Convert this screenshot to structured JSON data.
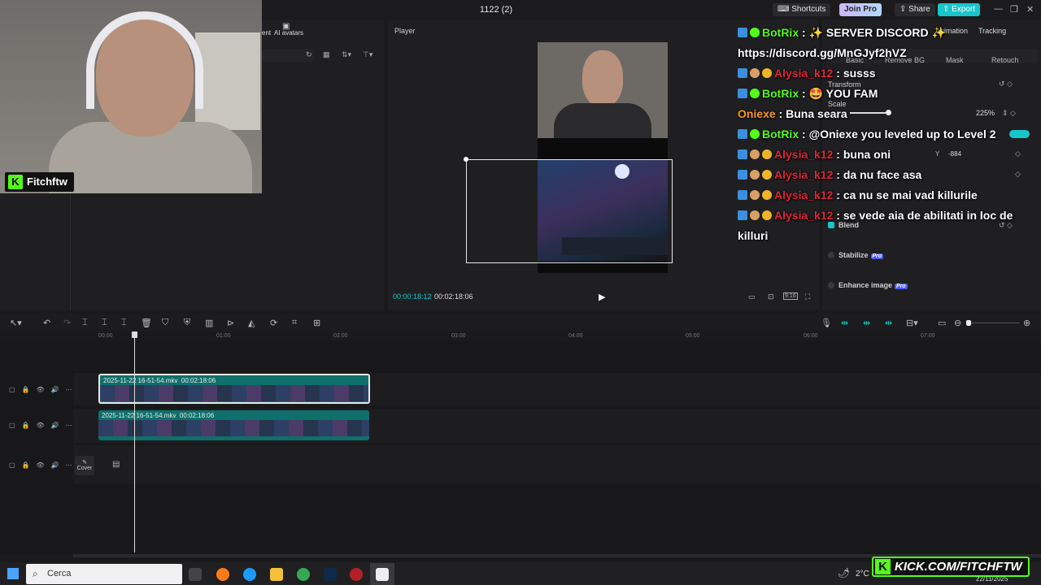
{
  "window": {
    "title": "1122 (2)"
  },
  "header": {
    "shortcuts_label": "Shortcuts",
    "join_pro_label": "Join Pro",
    "share_label": "Share",
    "export_label": "Export"
  },
  "left_panel": {
    "ai_avatars_label": "AI avatars",
    "left_cut_label": "ent"
  },
  "player": {
    "label": "Player",
    "current_time": "00:00:18:12",
    "total_time": "00:02:18:06",
    "ratio_label": "9:16"
  },
  "right_panel": {
    "tabs": [
      "Basic",
      "Remove BG",
      "Mask",
      "Retouch"
    ],
    "top_tabs": [
      "Animation",
      "Tracking"
    ],
    "transform_label": "Transform",
    "scale_label": "Scale",
    "scale_value": "225%",
    "scale_level": 0.75,
    "y_label": "Y",
    "y_value": "-884",
    "blend_label": "Blend",
    "stabilize_label": "Stabilize",
    "enhance_label": "Enhance image",
    "pro_badge": "Pro"
  },
  "chat": {
    "messages": [
      {
        "user": "BotRix",
        "color": "green",
        "badges": [
          "blue",
          "green"
        ],
        "text": ": ✨ SERVER DISCORD ✨ https://discord.gg/MnGJyf2hVZ"
      },
      {
        "user": "Alysia_k12",
        "color": "red",
        "badges": [
          "blue",
          "copper",
          "yellow"
        ],
        "text": ": susss"
      },
      {
        "user": "BotRix",
        "color": "green",
        "badges": [
          "blue",
          "green"
        ],
        "text": ": 🤩 YOU FAM"
      },
      {
        "user": "Oniexe",
        "color": "orange",
        "badges": [],
        "text": ": Buna seara"
      },
      {
        "user": "BotRix",
        "color": "green",
        "badges": [
          "blue",
          "green"
        ],
        "text": ": @Oniexe you leveled up to Level 2"
      },
      {
        "user": "Alysia_k12",
        "color": "red",
        "badges": [
          "blue",
          "copper",
          "yellow"
        ],
        "text": ": buna oni"
      },
      {
        "user": "Alysia_k12",
        "color": "red",
        "badges": [
          "blue",
          "copper",
          "yellow"
        ],
        "text": ": da nu face asa"
      },
      {
        "user": "Alysia_k12",
        "color": "red",
        "badges": [
          "blue",
          "copper",
          "yellow"
        ],
        "text": ": ca nu se mai vad killurile"
      },
      {
        "user": "Alysia_k12",
        "color": "red",
        "badges": [
          "blue",
          "copper",
          "yellow"
        ],
        "text": ": se vede aia de abilitati in loc de killuri"
      }
    ]
  },
  "webcam": {
    "streamer_name": "Fitchftw",
    "logo_letter": "K"
  },
  "timeline": {
    "ticks": [
      "00:00",
      "01:00",
      "02:00",
      "03:00",
      "04:00",
      "05:00",
      "06:00",
      "07:00"
    ],
    "clip1_label": "2025-11-22 16-51-54.mkv",
    "clip1_duration": "00:02:18:06",
    "clip2_label": "2025-11-22 16-51-54.mkv",
    "clip2_duration": "00:02:18:06",
    "cover_label": "Cover"
  },
  "taskbar": {
    "search_placeholder": "Cerca",
    "temperature": "2°C",
    "date": "22/11/2025",
    "kick_banner": "KICK.COM/FITCHFTW"
  }
}
